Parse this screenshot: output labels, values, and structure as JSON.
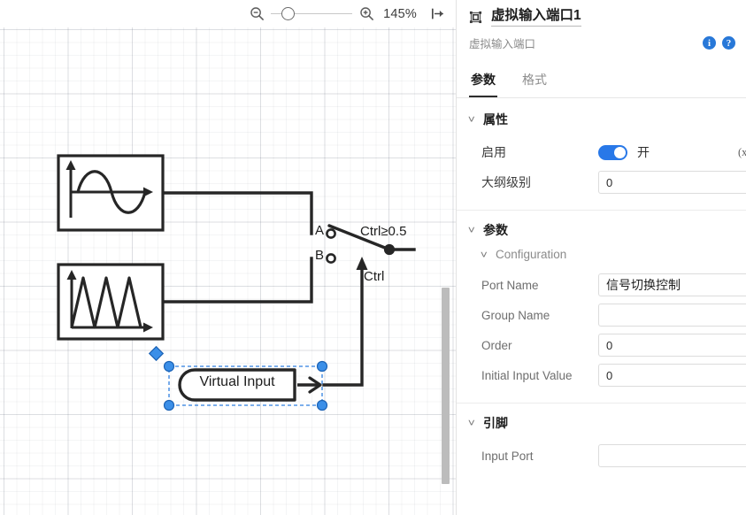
{
  "toolbar": {
    "zoom_out_icon": "zoom-out-icon",
    "zoom_in_icon": "zoom-in-icon",
    "zoom_percent": "145%",
    "collapse_icon": "collapse-panel-icon"
  },
  "canvas": {
    "blocks": [
      {
        "id": "sine-source",
        "icon": "sine-wave-icon",
        "label": ""
      },
      {
        "id": "sawtooth-source",
        "icon": "sawtooth-wave-icon",
        "label": ""
      },
      {
        "id": "virtual-input",
        "label": "Virtual Input",
        "selected": true
      }
    ],
    "switch": {
      "terminal_a": "A",
      "terminal_b": "B",
      "condition": "Ctrl≥0.5",
      "control": "Ctrl"
    }
  },
  "panel": {
    "title_icon": "frame-select-icon",
    "title": "虚拟输入端口1",
    "subtitle": "虚拟输入端口",
    "info_icon": "i",
    "help_icon": "?",
    "tabs": [
      {
        "label": "参数",
        "active": true
      },
      {
        "label": "格式",
        "active": false
      }
    ],
    "sections": {
      "attributes": {
        "title": "属性",
        "enable_label": "启用",
        "enable_value": "开",
        "outline_label": "大纲级别",
        "outline_value": "0"
      },
      "parameters": {
        "title": "参数",
        "subsection": "Configuration",
        "fields": [
          {
            "label": "Port Name",
            "value": "信号切换控制"
          },
          {
            "label": "Group Name",
            "value": ""
          },
          {
            "label": "Order",
            "value": "0"
          },
          {
            "label": "Initial Input Value",
            "value": "0"
          }
        ]
      },
      "pins": {
        "title": "引脚",
        "fields": [
          {
            "label": "Input Port",
            "value": ""
          }
        ]
      }
    },
    "fx_label": "(x)"
  }
}
